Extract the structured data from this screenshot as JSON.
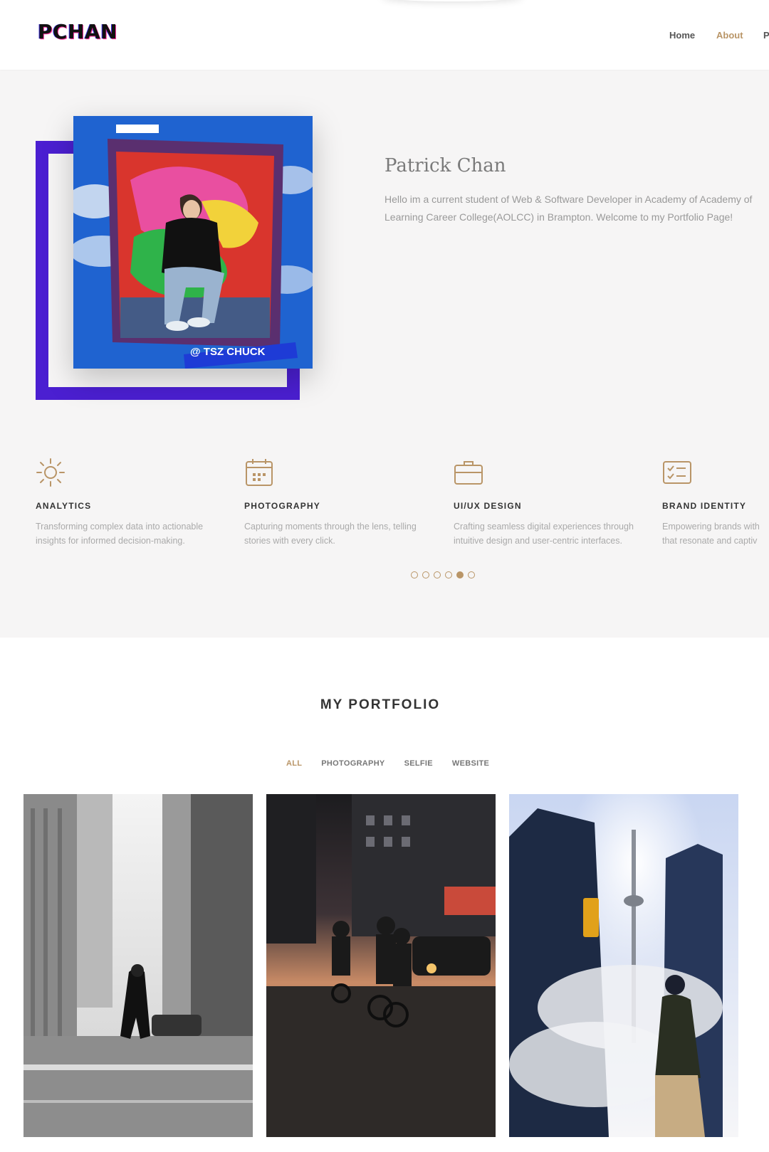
{
  "header": {
    "logo": "PCHAN",
    "nav": {
      "home": "Home",
      "about": "About",
      "partial": "P"
    }
  },
  "about": {
    "photo_caption": "@ TSZ CHUCK",
    "name": "Patrick Chan",
    "bio": "Hello im a current student of Web & Software Developer in Academy of Academy of Learning Career College(AOLCC) in Brampton. Welcome to my Portfolio Page!"
  },
  "services": [
    {
      "icon": "sun-icon",
      "title": "ANALYTICS",
      "description": "Transforming complex data into actionable insights for informed decision-making."
    },
    {
      "icon": "calendar-icon",
      "title": "PHOTOGRAPHY",
      "description": "Capturing moments through the lens, telling stories with every click."
    },
    {
      "icon": "briefcase-icon",
      "title": "UI/UX DESIGN",
      "description": "Crafting seamless digital experiences through intuitive design and user-centric interfaces."
    },
    {
      "icon": "checklist-icon",
      "title": "BRAND IDENTITY",
      "description": "Empowering brands with that resonate and captiv"
    }
  ],
  "carousel": {
    "page_count": 6,
    "active_index": 4
  },
  "portfolio": {
    "title": "MY PORTFOLIO",
    "filters": [
      "ALL",
      "PHOTOGRAPHY",
      "SELFIE",
      "WEBSITE"
    ],
    "active_filter": "ALL"
  },
  "colors": {
    "accent": "#b99567",
    "frame": "#4b1fd1",
    "section_bg": "#f6f5f5"
  }
}
